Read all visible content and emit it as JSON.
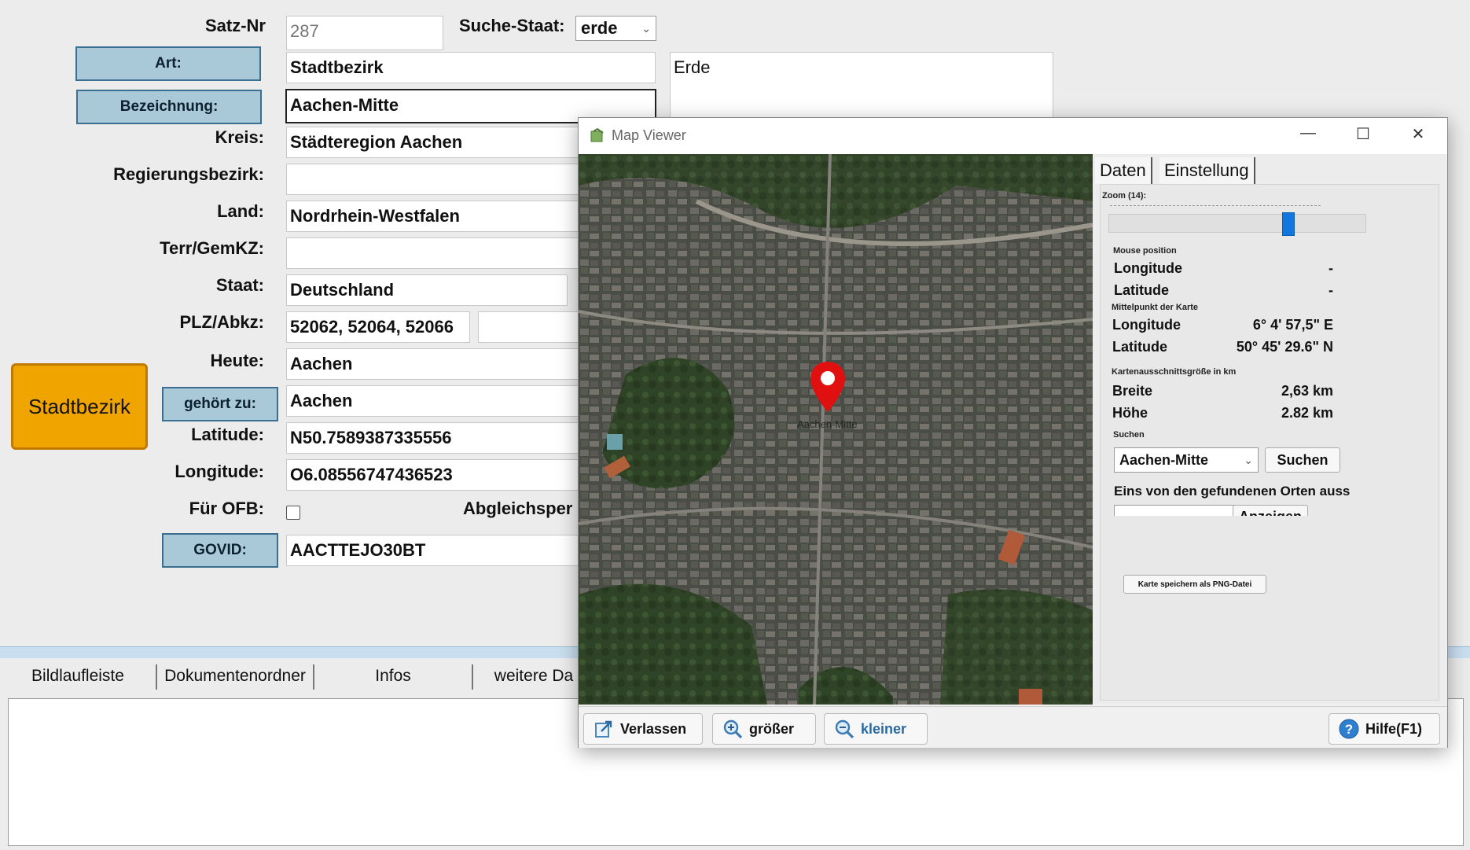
{
  "form": {
    "satz_nr_label": "Satz-Nr",
    "satz_nr_value": "287",
    "suche_staat_label": "Suche-Staat:",
    "suche_staat_value": "erde",
    "art_button": "Art:",
    "art_value": "Stadtbezirk",
    "note_text": "Erde",
    "bezeichnung_button": "Bezeichnung:",
    "bezeichnung_value": "Aachen-Mitte",
    "kreis_label": "Kreis:",
    "kreis_value": "Städteregion Aachen",
    "regierungsbezirk_label": "Regierungsbezirk:",
    "regierungsbezirk_value": "",
    "land_label": "Land:",
    "land_value": "Nordrhein-Westfalen",
    "terr_label": "Terr/GemKZ:",
    "terr_value": "",
    "staat_label": "Staat:",
    "staat_value": "Deutschland",
    "plz_label": "PLZ/Abkz:",
    "plz_value": "52062, 52064, 52066",
    "plz_value2": "",
    "heute_label": "Heute:",
    "heute_value": "Aachen",
    "big_sign": "Stadtbezirk",
    "gehoert_button": "gehört zu:",
    "gehoert_value": "Aachen",
    "latitude_label": "Latitude:",
    "latitude_value": "N50.7589387335556",
    "longitude_label": "Longitude:",
    "longitude_value": "O6.08556747436523",
    "fuer_ofb_label": "Für OFB:",
    "abgleich_label": "Abgleichsper",
    "govid_button": "GOVID:",
    "govid_value": "AACTTEJO30BT"
  },
  "bottom_tabs": [
    "Bildlaufleiste",
    "Dokumentenordner",
    "Infos",
    "weitere Da"
  ],
  "map_viewer": {
    "title": "Map Viewer",
    "marker_label": "Aachen-Mitte",
    "tabs": [
      "Daten",
      "Einstellung"
    ],
    "zoom_label": "Zoom (14):",
    "zoom_level": 14,
    "zoom_fraction": 0.71,
    "mouse_position_label": "Mouse position",
    "mouse_longitude_label": "Longitude",
    "mouse_longitude_value": "-",
    "mouse_latitude_label": "Latitude",
    "mouse_latitude_value": "-",
    "center_label": "Mittelpunkt der Karte",
    "center_longitude_label": "Longitude",
    "center_longitude_value": "6° 4' 57,5\" E",
    "center_latitude_label": "Latitude",
    "center_latitude_value": "50° 45' 29.6\" N",
    "size_label": "Kartenausschnittsgröße in km",
    "breite_label": "Breite",
    "breite_value": "2,63 km",
    "hoehe_label": "Höhe",
    "hoehe_value": "2.82 km",
    "suchen_label": "Suchen",
    "search_value": "Aachen-Mitte",
    "suchen_button": "Suchen",
    "found_label": "Eins von den gefundenen Orten auss",
    "anzeigen_button": "Anzeigen",
    "save_png_button": "Karte speichern als PNG-Datei",
    "footer": {
      "verlassen": "Verlassen",
      "groesser": "größer",
      "kleiner": "kleiner",
      "hilfe": "Hilfe(F1)"
    }
  },
  "colors": {
    "blue_button": "#a9c8d8",
    "sign_orange": "#f0a400",
    "marker_red": "#e01010",
    "slider_blue": "#1177dd"
  }
}
